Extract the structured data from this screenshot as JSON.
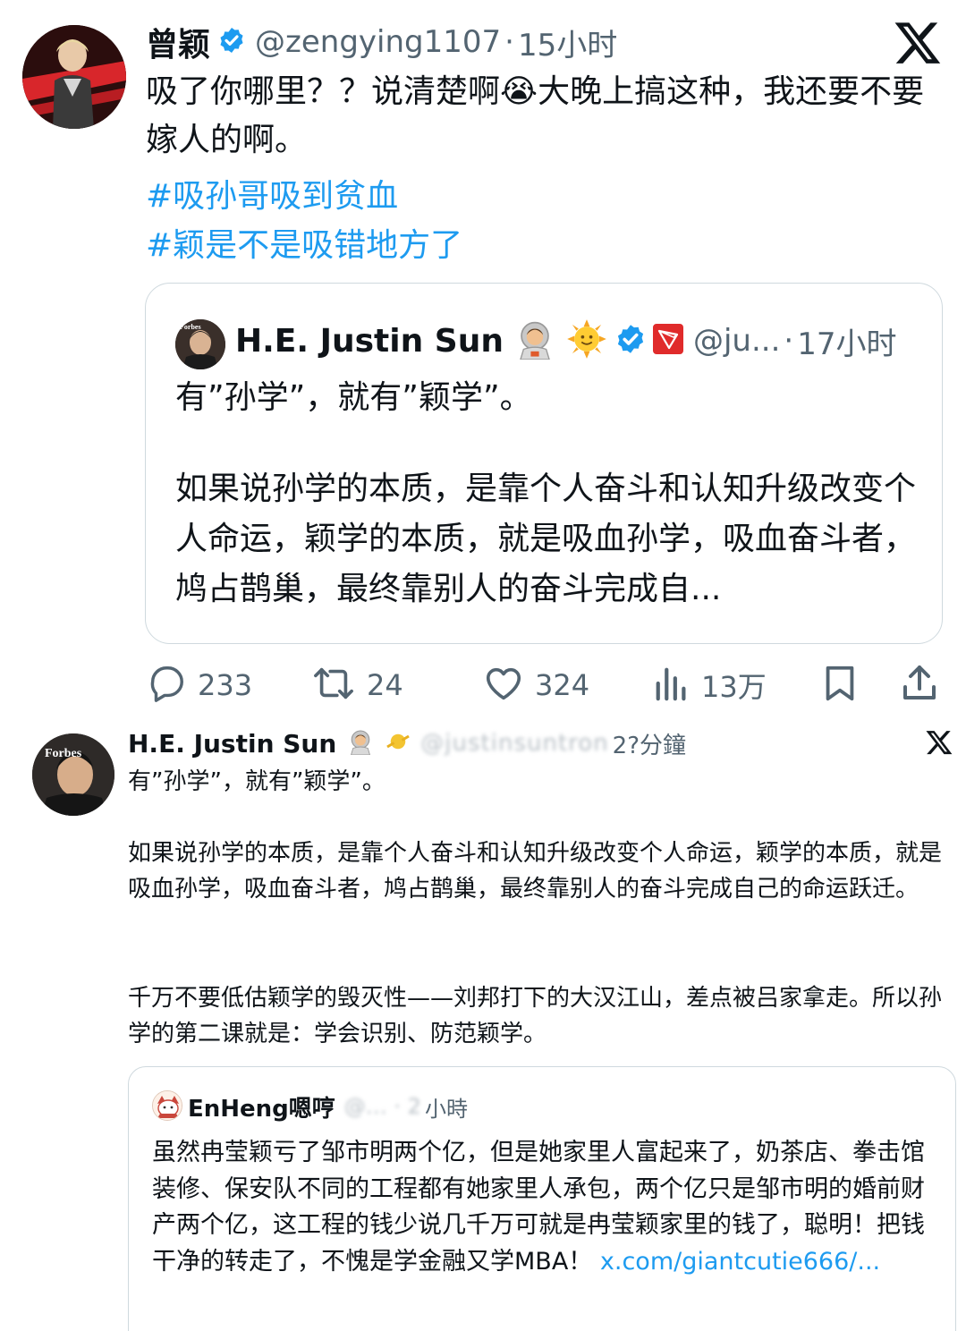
{
  "tweet1": {
    "author_name": "曾颖",
    "handle": "@zengying1107",
    "separator": "·",
    "time": "15小时",
    "text": "吸了你哪里？？说清楚啊😭大晚上搞这种，我还要不要嫁人的啊。",
    "hashtags": [
      "#吸孙哥吸到贫血",
      "#颖是不是吸错地方了"
    ],
    "quote": {
      "author_name": "H.E. Justin Sun",
      "emojis": "🧑‍🚀 🌞",
      "handle": "@ju...",
      "separator": "·",
      "time": "17小时",
      "line1": "有”孙学”，就有”颖学”。",
      "paragraph": "如果说孙学的本质，是靠个人奋斗和认知升级改变个人命运，颖学的本质，就是吸血孙学，吸血奋斗者，鸠占鹊巢，最终靠别人的奋斗完成自..."
    },
    "actions": {
      "replies": "233",
      "retweets": "24",
      "likes": "324",
      "views": "13万"
    }
  },
  "tweet2": {
    "author_name": "H.E. Justin Sun",
    "handle_blurred": "@justinsuntron",
    "time": "2?分鐘",
    "line1": "有”孙学”，就有”颖学”。",
    "paragraph1": "如果说孙学的本质，是靠个人奋斗和认知升级改变个人命运，颖学的本质，就是吸血孙学，吸血奋斗者，鸠占鹊巢，最终靠别人的奋斗完成自己的命运跃迁。",
    "paragraph2": "千万不要低估颖学的毁灭性——刘邦打下的大汉江山，差点被吕家拿走。所以孙学的第二课就是：学会识别、防范颖学。",
    "quote": {
      "author_name": "EnHeng嗯哼",
      "handle_blurred": "@… · 2",
      "time": "小時",
      "text": "虽然冉莹颖亏了邹市明两个亿，但是她家里人富起来了，奶茶店、拳击馆装修、保安队不同的工程都有她家里人承包，两个亿只是邹市明的婚前财产两个亿，这工程的钱少说几千万可就是冉莹颖家里的钱了，聪明！把钱干净的转走了，不愧是学金融又学MBA！",
      "link": "x.com/giantcutie666/..."
    }
  },
  "colors": {
    "text": "#0f1419",
    "secondary": "#536471",
    "link": "#1d9bf0",
    "border": "#cfd9de",
    "verified": "#1d9bf0"
  }
}
